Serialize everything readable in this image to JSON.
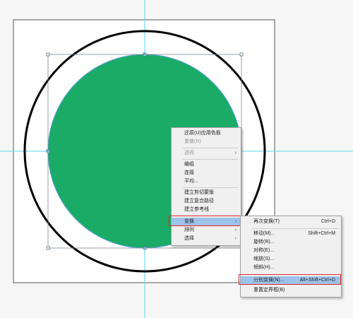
{
  "colors": {
    "artboard": "#ffffff",
    "circle_fill": "#1aab66",
    "outer_ring": "#000000",
    "guide": "#5ad5e6",
    "selection": "#5aa0d8",
    "menu_bg": "#f0f0f0",
    "menu_highlight": "#9ec3ea",
    "annotation_red": "#e0282c"
  },
  "context_menu": {
    "items": [
      {
        "label": "还原(U)应用色板",
        "enabled": true
      },
      {
        "label": "重做(R)",
        "enabled": false
      },
      {
        "label": "透视",
        "enabled": false,
        "submenu": true
      },
      {
        "label": "编组",
        "enabled": true
      },
      {
        "label": "连接",
        "enabled": true
      },
      {
        "label": "平均...",
        "enabled": true
      },
      {
        "label": "建立剪切蒙版",
        "enabled": true
      },
      {
        "label": "建立复合路径",
        "enabled": true
      },
      {
        "label": "建立参考线",
        "enabled": true
      },
      {
        "label": "变换",
        "enabled": true,
        "submenu": true,
        "highlighted": true
      },
      {
        "label": "排列",
        "enabled": true,
        "submenu": true
      },
      {
        "label": "选择",
        "enabled": true,
        "submenu": true
      }
    ]
  },
  "transform_submenu": {
    "items": [
      {
        "label": "再次变换(T)",
        "shortcut": "Ctrl+D"
      },
      {
        "label": "移动(M)...",
        "shortcut": "Shift+Ctrl+M"
      },
      {
        "label": "旋转(R)...",
        "shortcut": ""
      },
      {
        "label": "对称(E)...",
        "shortcut": ""
      },
      {
        "label": "缩放(S)...",
        "shortcut": ""
      },
      {
        "label": "倾斜(H)...",
        "shortcut": ""
      },
      {
        "label": "分别变换(N)...",
        "shortcut": "Alt+Shift+Ctrl+D",
        "highlighted": true
      },
      {
        "label": "重置定界框(B)",
        "shortcut": ""
      }
    ]
  }
}
